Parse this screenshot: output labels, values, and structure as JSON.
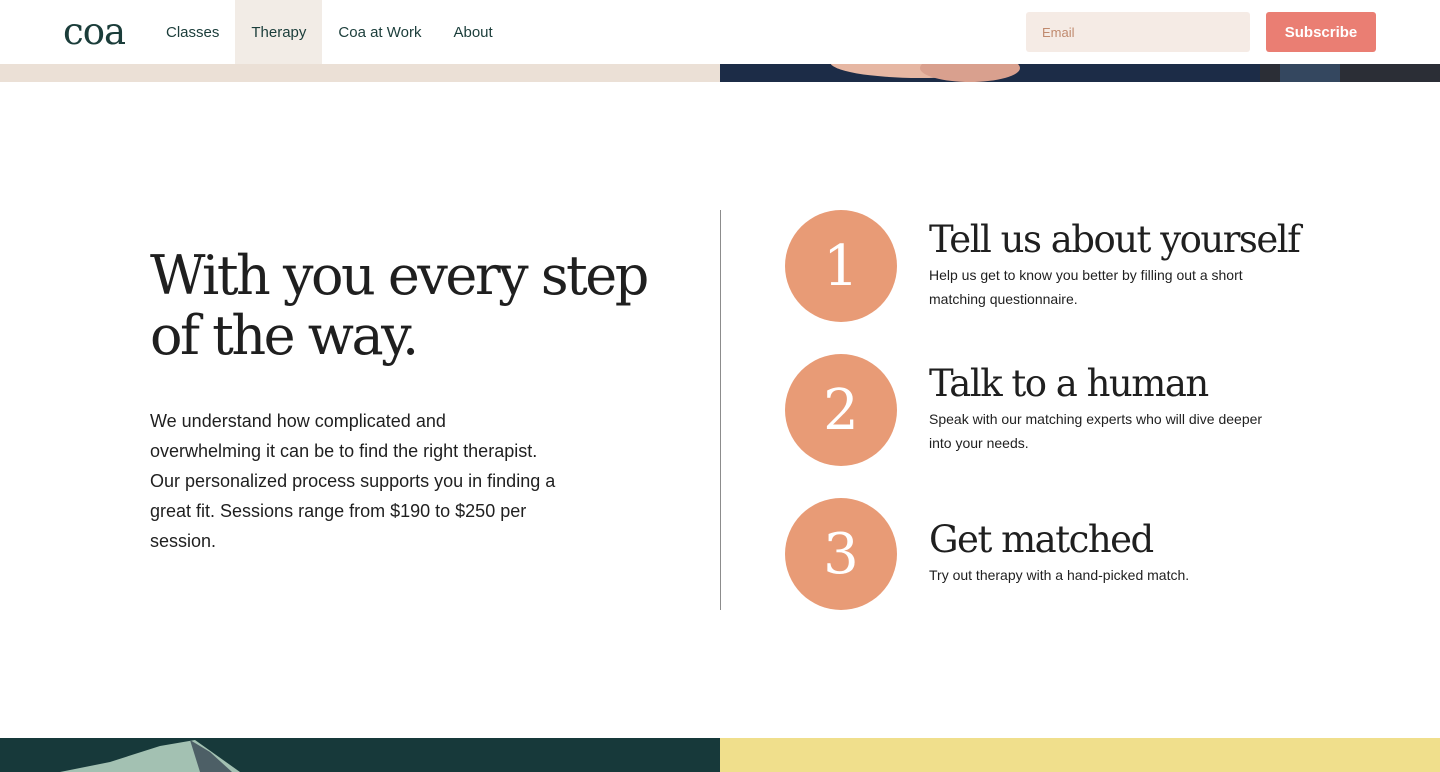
{
  "header": {
    "logo": "coa",
    "nav": [
      {
        "label": "Classes"
      },
      {
        "label": "Therapy"
      },
      {
        "label": "Coa at Work"
      },
      {
        "label": "About"
      }
    ],
    "active_nav": "Therapy",
    "email_placeholder": "Email",
    "subscribe_label": "Subscribe"
  },
  "section": {
    "headline": "With you every step of the way.",
    "intro": "We understand how complicated and overwhelming it can be to find the right therapist. Our personalized process supports you in finding a great fit. Sessions range from $190 to $250 per session.",
    "steps": [
      {
        "number": "1",
        "title": "Tell us about yourself",
        "description": "Help us get to know you better by filling out a short matching questionnaire."
      },
      {
        "number": "2",
        "title": "Talk to a human",
        "description": "Speak with our matching experts who will dive deeper into your needs."
      },
      {
        "number": "3",
        "title": "Get matched",
        "description": "Try out therapy with a hand-picked match."
      }
    ]
  },
  "colors": {
    "brand_dark": "#1b3d3a",
    "accent_coral": "#ea7e73",
    "step_circle": "#e89b76",
    "email_bg": "#f5ebe5",
    "beige": "#ebe0d6",
    "bottom_teal": "#17393a",
    "bottom_yellow": "#f0df8c"
  },
  "icons": [
    "coa-logo",
    "photo-banner",
    "illustration-mountain"
  ]
}
